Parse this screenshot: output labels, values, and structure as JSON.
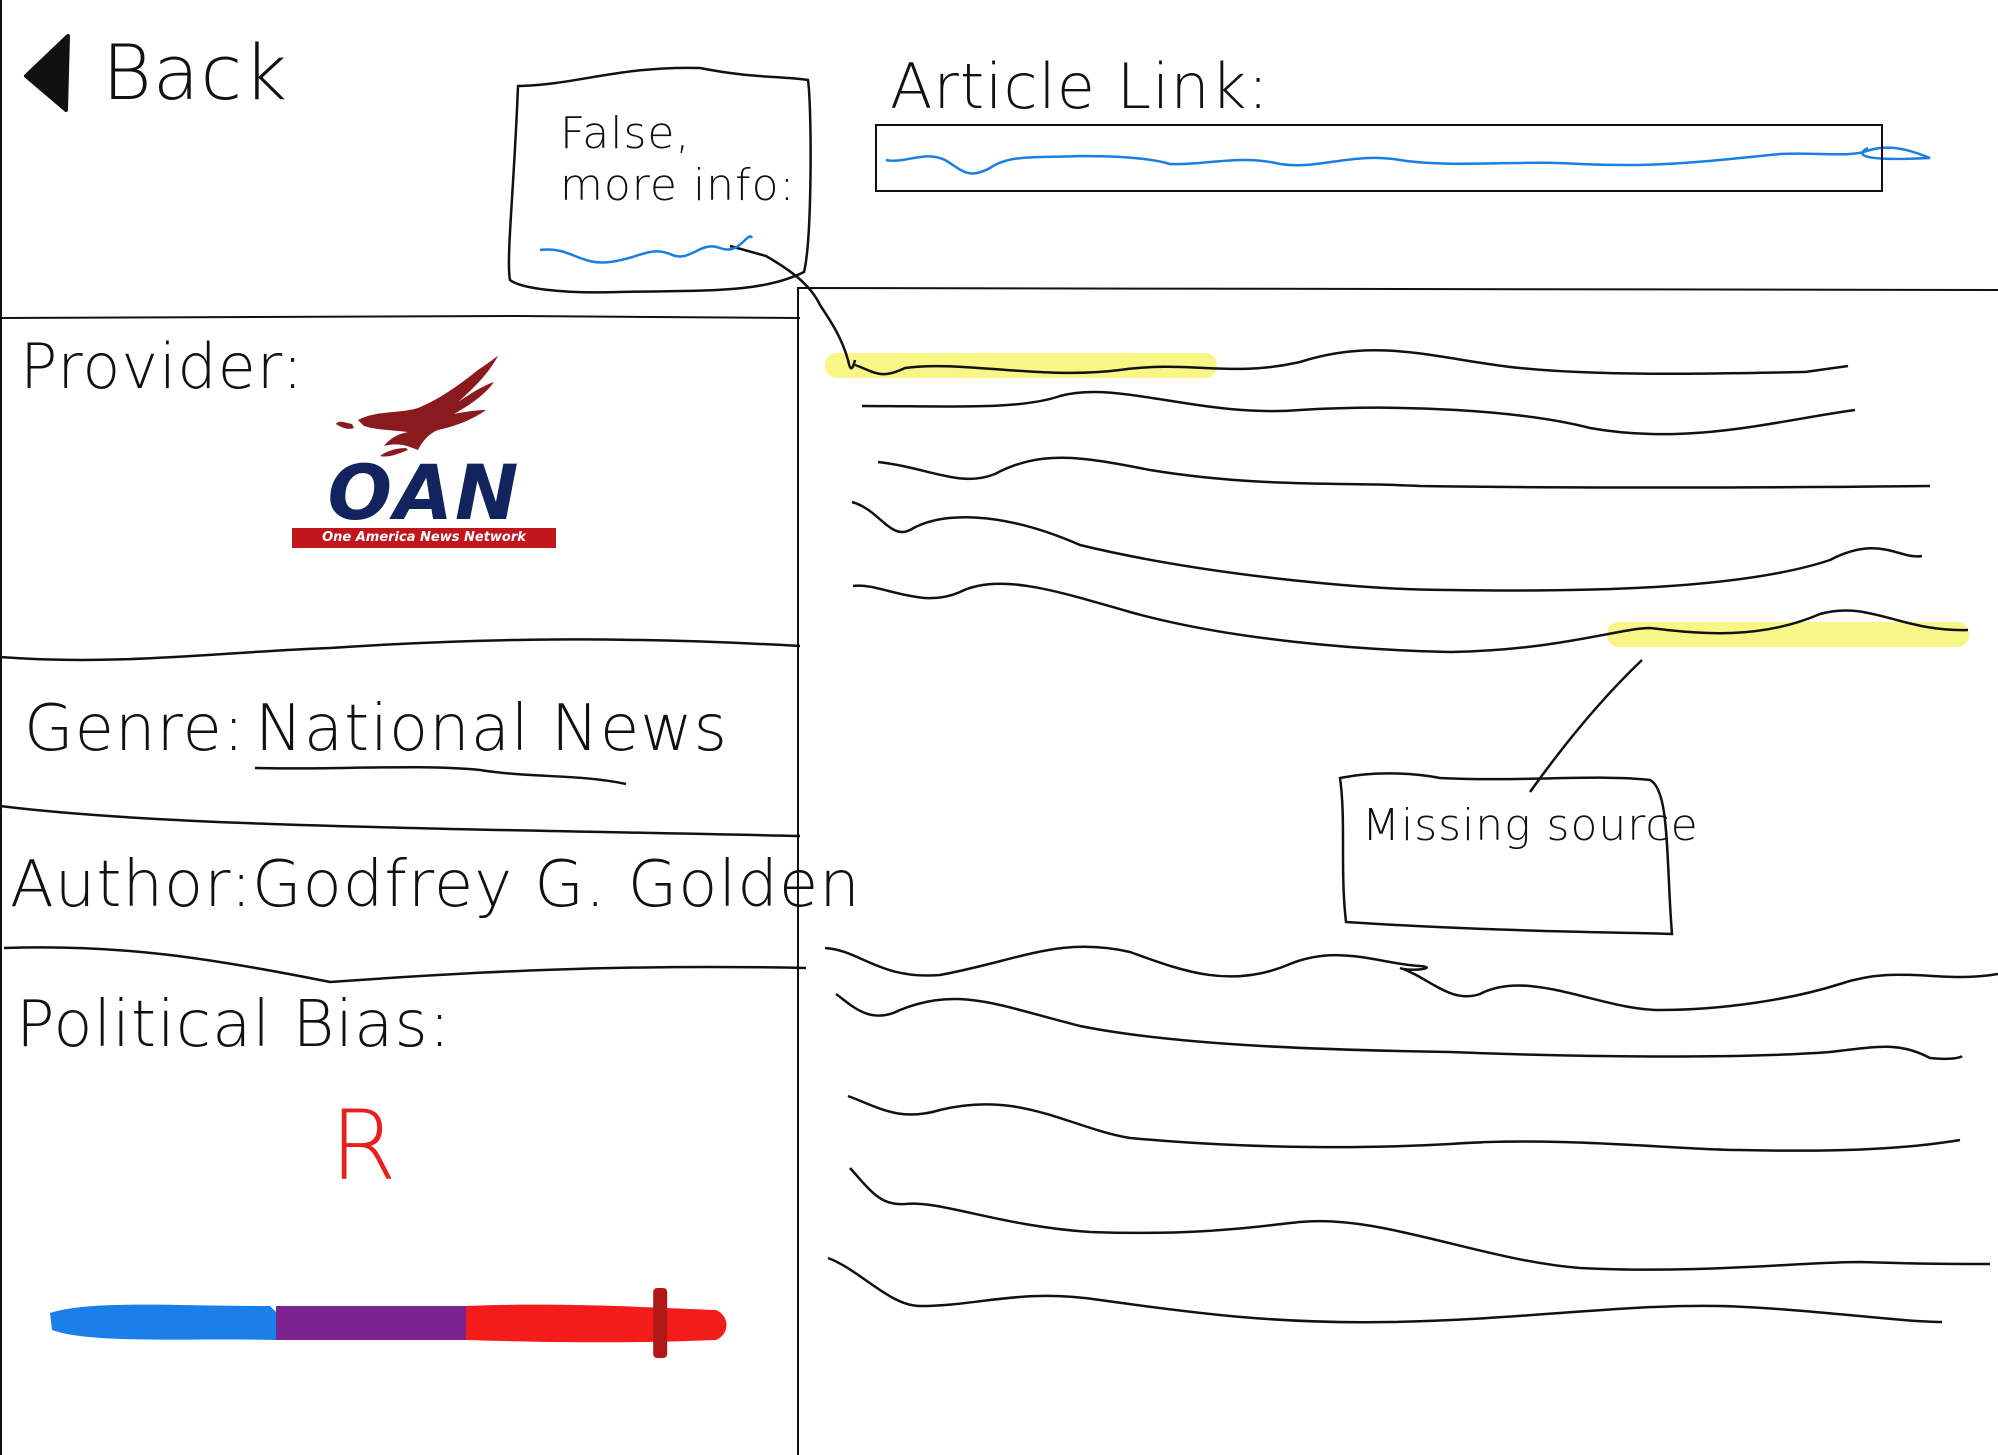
{
  "nav": {
    "back_label": "Back"
  },
  "article_link": {
    "label": "Article Link:",
    "value_color": "#1a7fe0"
  },
  "callouts": {
    "false_info": "False, more info:",
    "missing_source": "Missing source"
  },
  "details": {
    "provider_label": "Provider:",
    "provider_logo": {
      "wordmark": "OAN",
      "tagline": "One America News Network",
      "brand_navy": "#12235e",
      "brand_red": "#c0161c",
      "icon": "eagle-icon"
    },
    "genre_label": "Genre:",
    "genre_value": "National News",
    "author_label": "Author:",
    "author_value": "Godfrey G. Golden",
    "bias_label": "Political Bias:",
    "bias_letter": "R",
    "bias_scale": {
      "segments": [
        {
          "name": "left",
          "color": "#1a7fe8"
        },
        {
          "name": "center",
          "color": "#7b2490"
        },
        {
          "name": "right",
          "color": "#f41b1b"
        }
      ],
      "marker_color": "#b31818",
      "marker_level": 0.9
    }
  },
  "highlight_color": "#f7f57a"
}
